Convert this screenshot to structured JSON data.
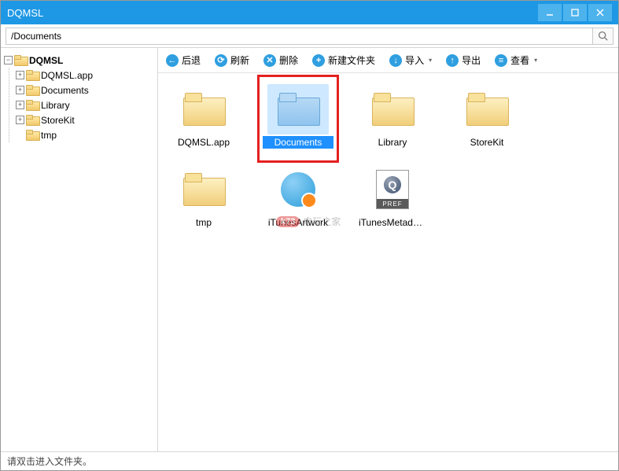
{
  "window": {
    "title": "DQMSL"
  },
  "search": {
    "value": "/Documents"
  },
  "tree": {
    "root": "DQMSL",
    "children": [
      "DQMSL.app",
      "Documents",
      "Library",
      "StoreKit",
      "tmp"
    ]
  },
  "toolbar": {
    "back": "后退",
    "refresh": "刷新",
    "delete": "删除",
    "newfolder": "新建文件夹",
    "import": "导入",
    "export": "导出",
    "view": "查看"
  },
  "items": [
    {
      "label": "DQMSL.app",
      "type": "folder"
    },
    {
      "label": "Documents",
      "type": "folder",
      "selected": true
    },
    {
      "label": "Library",
      "type": "folder"
    },
    {
      "label": "StoreKit",
      "type": "folder"
    },
    {
      "label": "tmp",
      "type": "folder"
    },
    {
      "label": "iTunesArtwork",
      "type": "artwork"
    },
    {
      "label": "iTunesMetadata.p...",
      "type": "pref"
    }
  ],
  "status": "请双击进入文件夹。",
  "watermark": {
    "badge": "k73",
    "text": "电玩之家"
  },
  "colors": {
    "titlebar": "#1e98e4",
    "highlight": "#e52020",
    "tb_back": "#2f9fe0",
    "tb_refresh": "#2f9fe0",
    "tb_delete": "#2f9fe0",
    "tb_new": "#2f9fe0",
    "tb_import": "#2f9fe0",
    "tb_export": "#2f9fe0",
    "tb_view": "#2f9fe0"
  }
}
